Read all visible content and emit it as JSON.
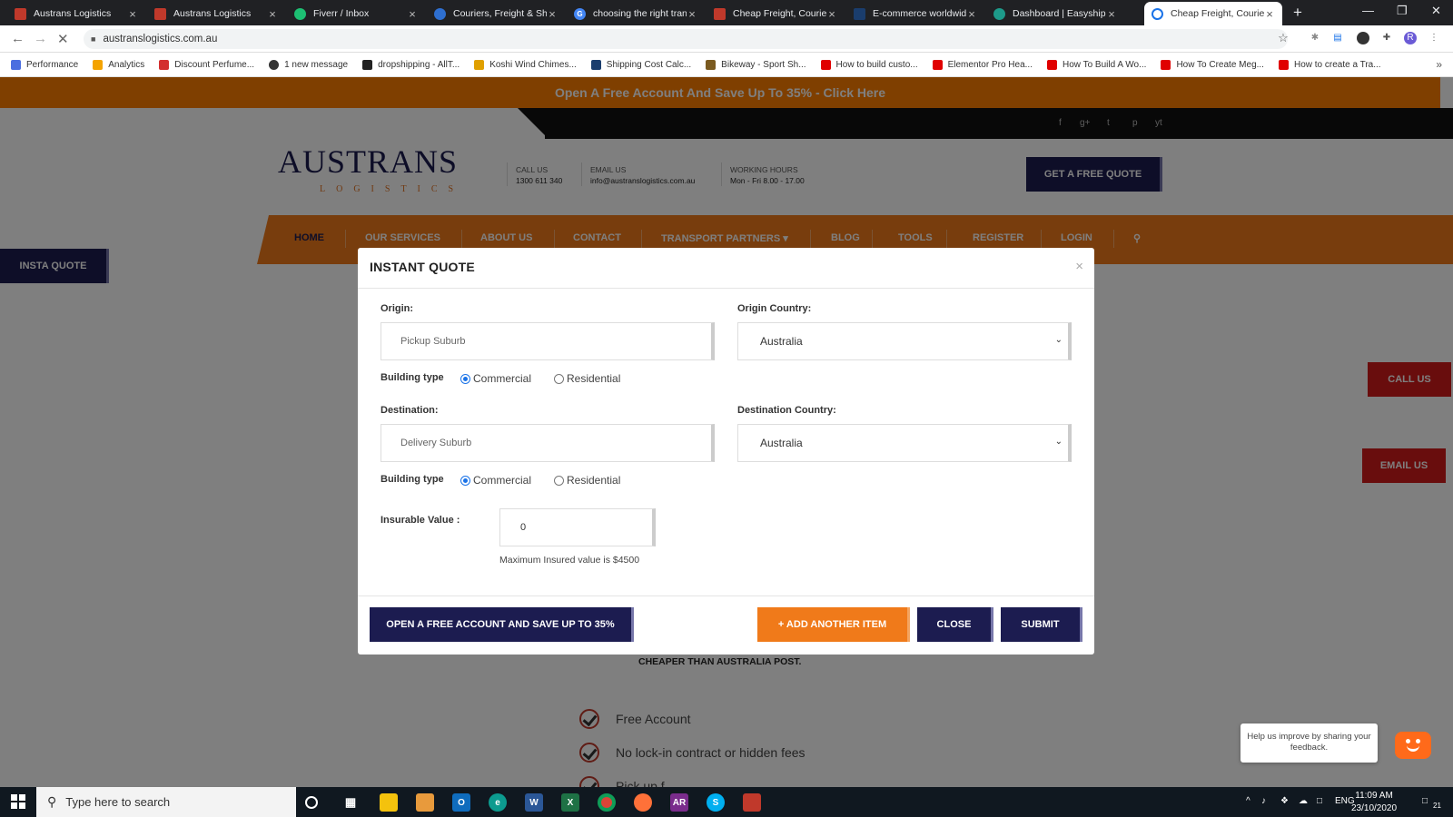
{
  "browser": {
    "tabs": [
      {
        "title": "Austrans Logistics",
        "color": "#c0392b"
      },
      {
        "title": "Austrans Logistics",
        "color": "#c0392b"
      },
      {
        "title": "Fiverr / Inbox",
        "color": "#1dbf73"
      },
      {
        "title": "Couriers, Freight & Ship",
        "color": "#2e6fd0"
      },
      {
        "title": "choosing the right tran",
        "color": "#4285f4"
      },
      {
        "title": "Cheap Freight, Courier",
        "color": "#c0392b"
      },
      {
        "title": "E-commerce worldwide",
        "color": "#1a3d6d"
      },
      {
        "title": "Dashboard | Easyship",
        "color": "#1d9a8a"
      },
      {
        "title": "Cheap Freight, Courier",
        "color": "#1a73e8"
      }
    ],
    "active_tab_index": 8,
    "url": "austranslogistics.com.au",
    "bookmarks": [
      {
        "label": "Performance",
        "color": "#4a6ee0"
      },
      {
        "label": "Analytics",
        "color": "#f4a300"
      },
      {
        "label": "Discount Perfume...",
        "color": "#d32f2f"
      },
      {
        "label": "1 new message",
        "color": "#333333"
      },
      {
        "label": "dropshipping - AllT...",
        "color": "#222222"
      },
      {
        "label": "Koshi Wind Chimes...",
        "color": "#e0a000"
      },
      {
        "label": "Shipping Cost Calc...",
        "color": "#1a3d6d"
      },
      {
        "label": "Bikeway - Sport Sh...",
        "color": "#7a5a20"
      },
      {
        "label": "How to build custo...",
        "color": "#e00000"
      },
      {
        "label": "Elementor Pro Hea...",
        "color": "#e00000"
      },
      {
        "label": "How To Build A Wo...",
        "color": "#e00000"
      },
      {
        "label": "How To Create Meg...",
        "color": "#e00000"
      },
      {
        "label": "How to create a Tra...",
        "color": "#e00000"
      }
    ],
    "more": "»",
    "new_tab": "+",
    "window_controls": {
      "minimize": "—",
      "restore": "❐",
      "close": "✕"
    }
  },
  "site": {
    "promo": "Open A Free Account And Save Up To 35% - Click Here",
    "social_icons": [
      "f",
      "g+",
      "t",
      "p",
      "yt"
    ],
    "logo": {
      "main": "AUSTRANS",
      "sub": "LOGISTICS"
    },
    "contact": {
      "call_label": "CALL US",
      "call_value": "1300 611 340",
      "email_label": "EMAIL US",
      "email_value": "info@austranslogistics.com.au",
      "hours_label": "WORKING HOURS",
      "hours_value": "Mon - Fri 8.00 - 17.00"
    },
    "quote_button": "GET A FREE QUOTE",
    "nav": [
      "HOME",
      "OUR SERVICES",
      "ABOUT US",
      "CONTACT",
      "TRANSPORT PARTNERS ▾",
      "BLOG",
      "TOOLS",
      "REGISTER",
      "LOGIN"
    ],
    "insta_quote": "INSTA QUOTE",
    "call_us": "CALL US",
    "email_us": "EMAIL US",
    "cheaper": "CHEAPER THAN AUSTRALIA POST.",
    "features": [
      "Free Account",
      "No lock-in contract or hidden fees",
      "Pick up f"
    ],
    "feedback": "Help us improve by sharing your feedback."
  },
  "modal": {
    "title": "INSTANT QUOTE",
    "close_icon": "×",
    "origin_label": "Origin:",
    "origin_placeholder": "Pickup Suburb",
    "origin_country_label": "Origin Country:",
    "origin_country_value": "Australia",
    "building_type_label": "Building type",
    "commercial": "Commercial",
    "residential": "Residential",
    "destination_label": "Destination:",
    "destination_placeholder": "Delivery Suburb",
    "destination_country_label": "Destination Country:",
    "destination_country_value": "Australia",
    "insurable_label": "Insurable Value :",
    "insurable_value": "0",
    "insured_hint": "Maximum Insured value is $4500",
    "open_account_button": "OPEN A FREE ACCOUNT AND SAVE UP TO 35%",
    "add_item_button": "+ ADD ANOTHER ITEM",
    "close_button": "CLOSE",
    "submit_button": "SUBMIT"
  },
  "taskbar": {
    "search_placeholder": "Type here to search",
    "tray_lang": "ENG",
    "time": "11:09 AM",
    "date": "23/10/2020",
    "notifications": "21"
  }
}
